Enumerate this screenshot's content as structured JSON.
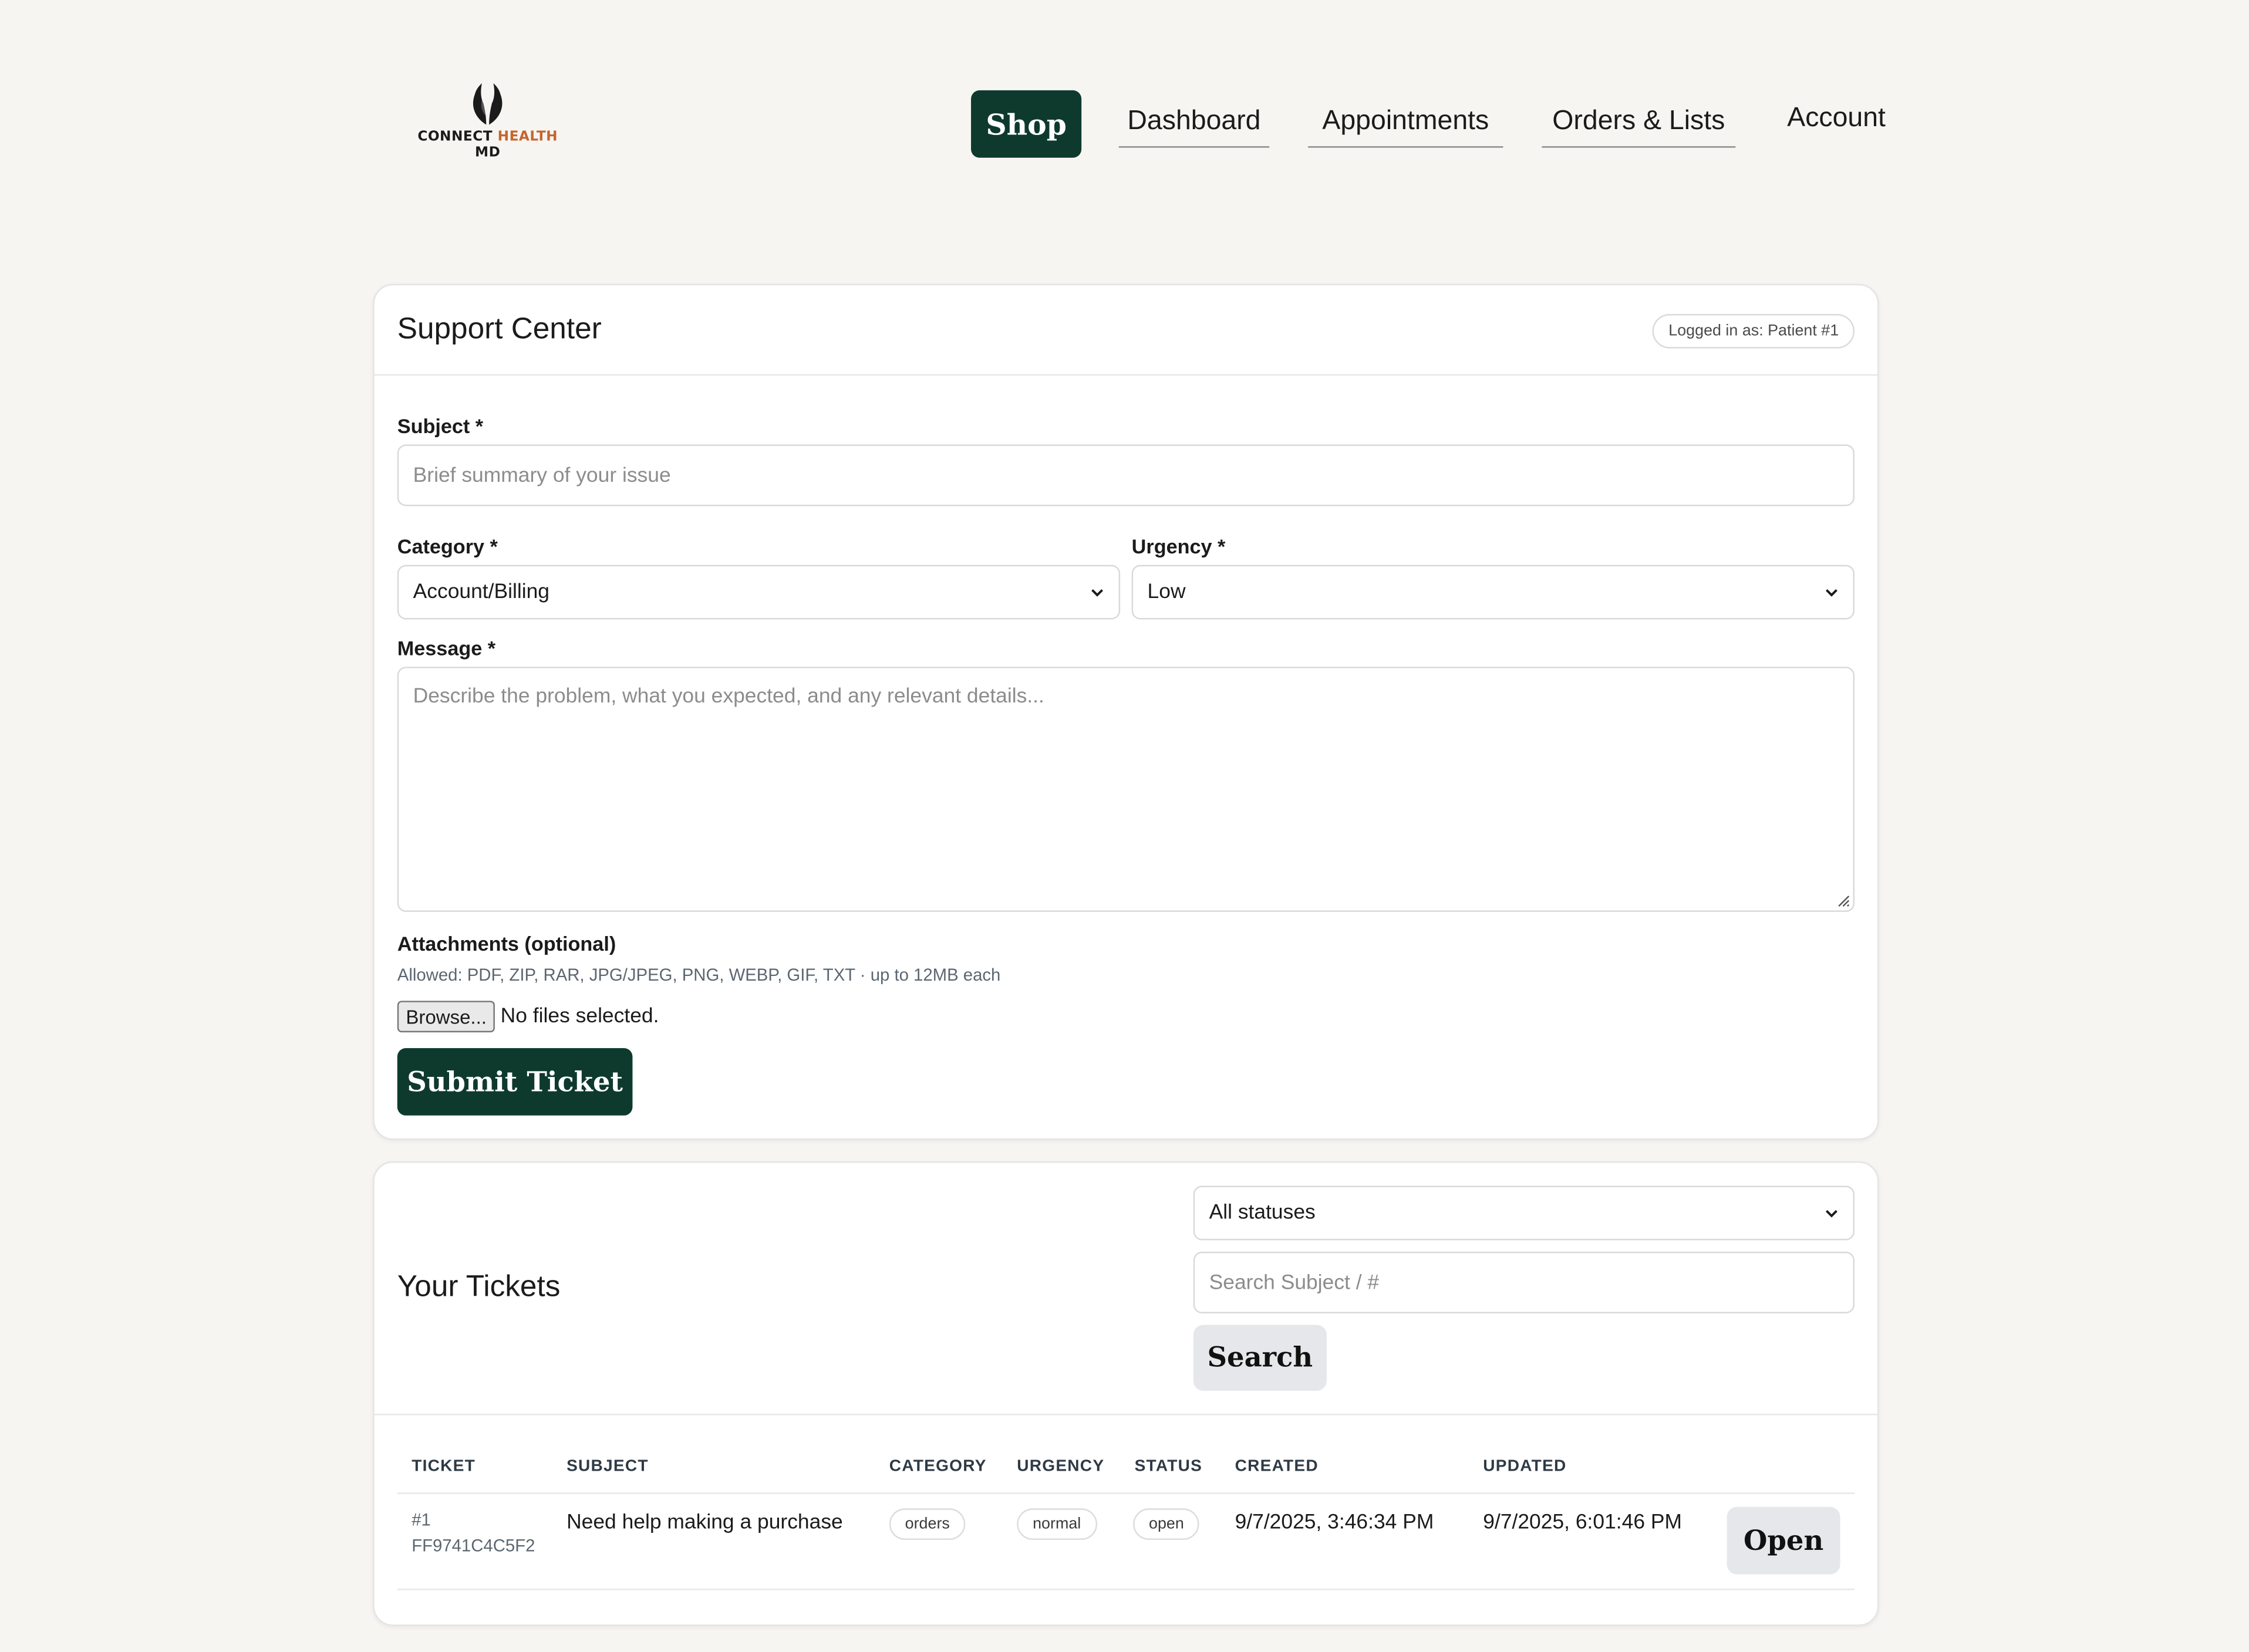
{
  "brand": {
    "line1_a": "CONNECT",
    "line1_b": "HEALTH",
    "line2": "MD",
    "accent_color": "#c5652d"
  },
  "nav": {
    "shop": "Shop",
    "dashboard": "Dashboard",
    "appointments": "Appointments",
    "orders": "Orders & Lists",
    "account": "Account",
    "primary_color": "#0e3a2e"
  },
  "support": {
    "title": "Support Center",
    "logged_in": "Logged in as: Patient #1",
    "subject_label": "Subject *",
    "subject_placeholder": "Brief summary of your issue",
    "category_label": "Category *",
    "category_value": "Account/Billing",
    "urgency_label": "Urgency *",
    "urgency_value": "Low",
    "message_label": "Message *",
    "message_placeholder": "Describe the problem, what you expected, and any relevant details...",
    "attachments_label": "Attachments (optional)",
    "attachments_hint": "Allowed: PDF, ZIP, RAR, JPG/JPEG, PNG, WEBP, GIF, TXT · up to 12MB each",
    "browse_label": "Browse...",
    "no_files": "No files selected.",
    "submit_label": "Submit Ticket"
  },
  "tickets": {
    "title": "Your Tickets",
    "status_filter": "All statuses",
    "search_placeholder": "Search Subject / #",
    "search_label": "Search",
    "columns": {
      "ticket": "TICKET",
      "subject": "SUBJECT",
      "category": "CATEGORY",
      "urgency": "URGENCY",
      "status": "STATUS",
      "created": "CREATED",
      "updated": "UPDATED"
    },
    "rows": [
      {
        "number": "#1",
        "code": "FF9741C4C5F2",
        "subject": "Need help making a purchase",
        "category": "orders",
        "urgency": "normal",
        "status": "open",
        "created": "9/7/2025, 3:46:34 PM",
        "updated": "9/7/2025, 6:01:46 PM",
        "action": "Open"
      }
    ]
  }
}
